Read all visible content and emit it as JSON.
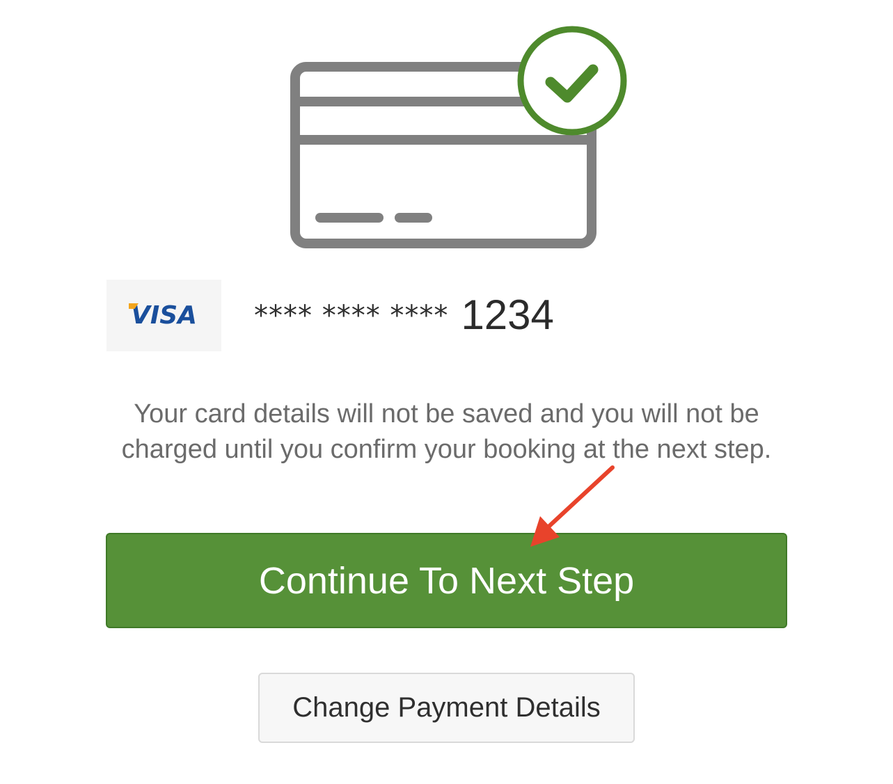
{
  "card": {
    "brand": "VISA",
    "masked_groups": "**** **** ****",
    "last_four": "1234"
  },
  "notice": {
    "text": "Your card details will not be saved and you will not be charged until you confirm your booking at the next step."
  },
  "buttons": {
    "continue_label": "Continue To Next Step",
    "change_label": "Change Payment Details"
  },
  "colors": {
    "primary_green": "#569138",
    "check_green": "#4e8a2c",
    "card_outline_gray": "#808080",
    "visa_blue": "#1a4f9c",
    "visa_gold": "#f3a51c",
    "annotation_red": "#e8432b"
  },
  "icons": {
    "illustration": "credit-card-verified-icon",
    "annotation": "red-arrow-pointer"
  }
}
